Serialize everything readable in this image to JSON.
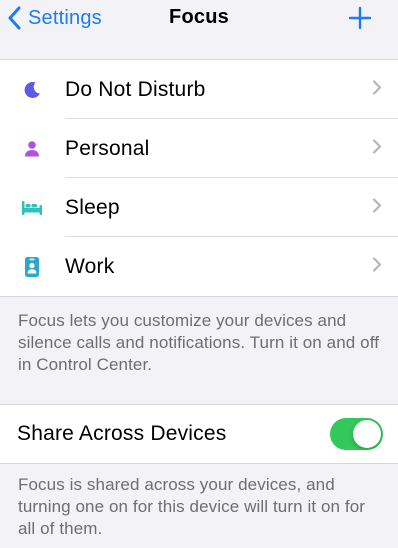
{
  "nav": {
    "back_label": "Settings",
    "title": "Focus",
    "back_icon": "chevron-left-icon",
    "add_icon": "plus-icon",
    "accent_color": "#1b7cf5"
  },
  "focus_modes": [
    {
      "label": "Do Not Disturb",
      "icon": "moon-icon",
      "color": "#5e5ce6"
    },
    {
      "label": "Personal",
      "icon": "person-icon",
      "color": "#af52de"
    },
    {
      "label": "Sleep",
      "icon": "bed-icon",
      "color": "#30c2b8"
    },
    {
      "label": "Work",
      "icon": "id-badge-icon",
      "color": "#30a7c8"
    }
  ],
  "focus_footnote": "Focus lets you customize your devices and silence calls and notifications. Turn it on and off in Control Center.",
  "share": {
    "label": "Share Across Devices",
    "enabled": true,
    "toggle_color": "#34c759",
    "footnote": "Focus is shared across your devices, and turning one on for this device will turn it on for all of them."
  }
}
